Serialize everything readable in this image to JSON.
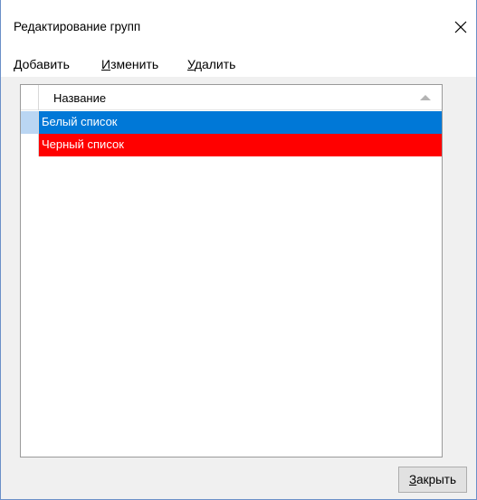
{
  "window": {
    "title": "Редактирование групп"
  },
  "menu": {
    "add": {
      "accel": "Д",
      "rest": "обавить"
    },
    "edit": {
      "accel": "И",
      "rest": "зменить"
    },
    "delete": {
      "accel": "У",
      "rest": "далить"
    }
  },
  "grid": {
    "column_header": "Название",
    "sort_icon": "sort-ascending-icon",
    "rows": [
      {
        "name": "Белый список",
        "color": "#0078d7",
        "selector_color": "#bad6f3"
      },
      {
        "name": "Черный список",
        "color": "#ff0000",
        "selector_color": "#ffffff"
      }
    ]
  },
  "footer": {
    "close_button": {
      "accel": "З",
      "rest": "акрыть"
    }
  }
}
